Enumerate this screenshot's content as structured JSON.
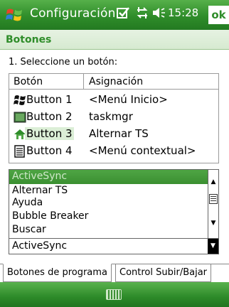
{
  "titlebar": {
    "title": "Configuración",
    "time": "15:28",
    "ok_label": "ok",
    "icons": [
      "windows-logo-icon",
      "checkbox-icon",
      "connectivity-icon",
      "speaker-icon"
    ]
  },
  "page": {
    "heading": "Botones",
    "instruction": "1. Seleccione un botón:"
  },
  "table": {
    "columns": [
      "Botón",
      "Asignación"
    ],
    "rows": [
      {
        "name": "Button 1",
        "assignment": "<Menú Inicio>",
        "icon": "windows-flag-icon"
      },
      {
        "name": "Button 2",
        "assignment": "taskmgr",
        "icon": "taskmgr-icon"
      },
      {
        "name": "Button 3",
        "assignment": "Alternar TS",
        "icon": "home-icon"
      },
      {
        "name": "Button 4",
        "assignment": "<Menú contextual>",
        "icon": "context-menu-icon"
      }
    ],
    "selected_row": "Button 3"
  },
  "list": {
    "items": [
      "ActiveSync",
      "Alternar TS",
      "Ayuda",
      "Bubble Breaker",
      "Buscar"
    ],
    "selected": "ActiveSync"
  },
  "combo": {
    "value": "ActiveSync"
  },
  "tabs": [
    {
      "label": "Botones de programa",
      "active": true
    },
    {
      "label": "Control Subir/Bajar",
      "active": false
    }
  ],
  "colors": {
    "accent": "#2f8d2a",
    "selection": "#3a8f31",
    "row_highlight": "#dbeed6"
  }
}
